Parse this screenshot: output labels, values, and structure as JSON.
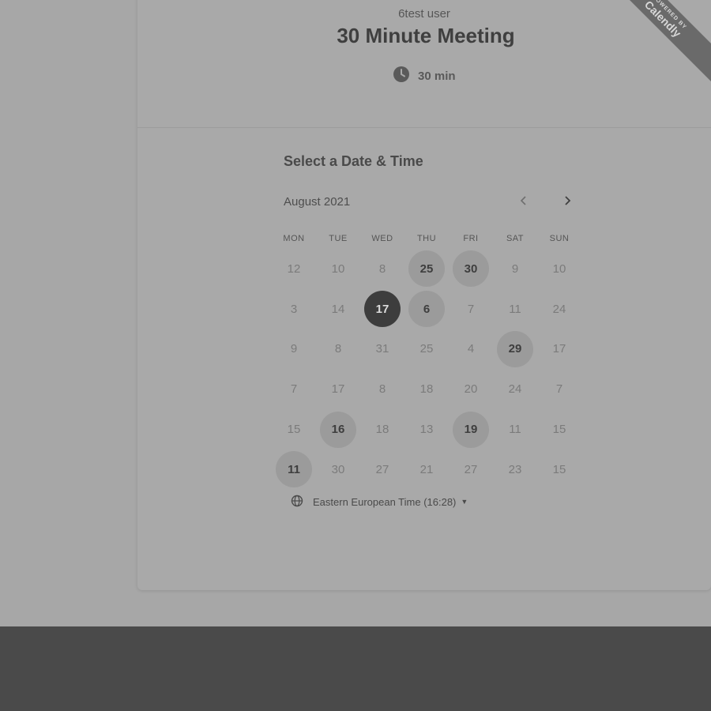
{
  "header": {
    "host_name": "6test user",
    "event_title": "30 Minute Meeting",
    "duration": "30 min",
    "duration_icon": "clock-icon",
    "ribbon_small": "POWERED BY",
    "ribbon_brand": "Calendly"
  },
  "calendar": {
    "section_title": "Select a Date & Time",
    "month_label": "August 2021",
    "prev_icon": "chevron-left-icon",
    "next_icon": "chevron-right-icon",
    "weekdays": [
      "MON",
      "TUE",
      "WED",
      "THU",
      "FRI",
      "SAT",
      "SUN"
    ],
    "weeks": [
      [
        {
          "d": "12"
        },
        {
          "d": "10"
        },
        {
          "d": "8"
        },
        {
          "d": "25",
          "s": "avail"
        },
        {
          "d": "30",
          "s": "avail"
        },
        {
          "d": "9"
        },
        {
          "d": "10"
        }
      ],
      [
        {
          "d": "3"
        },
        {
          "d": "14"
        },
        {
          "d": "17",
          "s": "selected"
        },
        {
          "d": "6",
          "s": "avail"
        },
        {
          "d": "7"
        },
        {
          "d": "11"
        },
        {
          "d": "24"
        }
      ],
      [
        {
          "d": "9"
        },
        {
          "d": "8"
        },
        {
          "d": "31"
        },
        {
          "d": "25"
        },
        {
          "d": "4"
        },
        {
          "d": "29",
          "s": "avail"
        },
        {
          "d": "17"
        }
      ],
      [
        {
          "d": "7"
        },
        {
          "d": "17"
        },
        {
          "d": "8"
        },
        {
          "d": "18"
        },
        {
          "d": "20"
        },
        {
          "d": "24"
        },
        {
          "d": "7"
        }
      ],
      [
        {
          "d": "15"
        },
        {
          "d": "16",
          "s": "avail"
        },
        {
          "d": "18"
        },
        {
          "d": "13"
        },
        {
          "d": "19",
          "s": "avail"
        },
        {
          "d": "11"
        },
        {
          "d": "15"
        }
      ],
      [
        {
          "d": "11",
          "s": "avail"
        },
        {
          "d": "30"
        },
        {
          "d": "27"
        },
        {
          "d": "21"
        },
        {
          "d": "27"
        },
        {
          "d": "23"
        },
        {
          "d": "15"
        }
      ]
    ]
  },
  "timezone": {
    "label": "Eastern European Time (16:28)",
    "icon": "globe-icon"
  },
  "colors": {
    "page_bg": "#a7a7a7",
    "footer_band": "#4a4a4a",
    "selected_day": "#3d3d3d",
    "available_day": "#9b9b9b"
  }
}
